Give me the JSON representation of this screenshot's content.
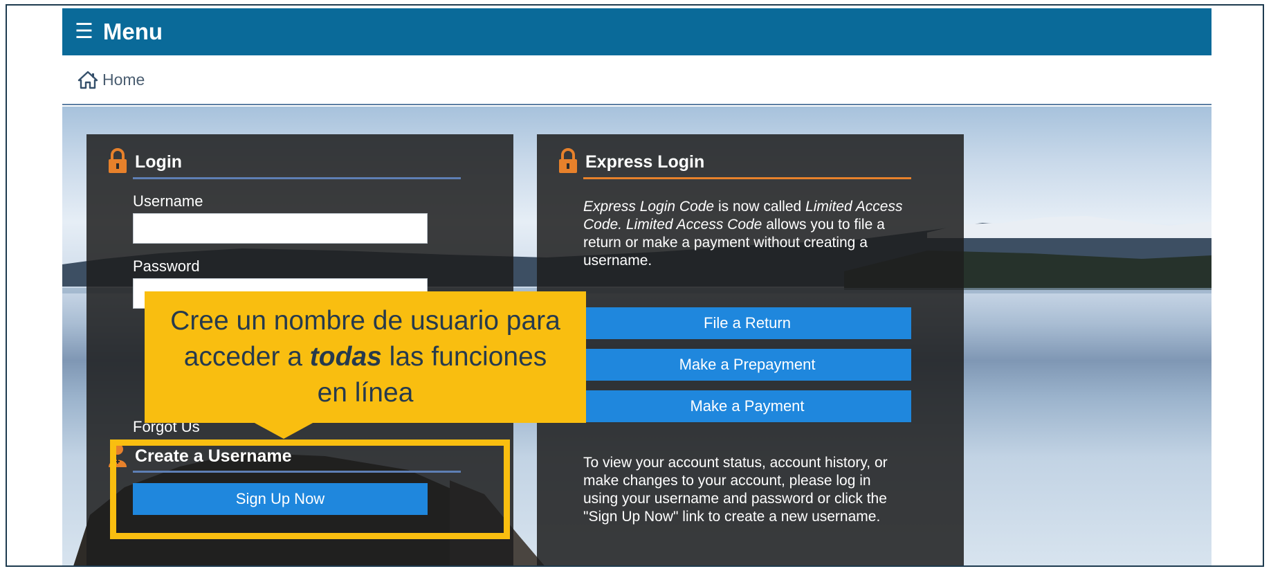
{
  "appbar": {
    "menu_label": "Menu",
    "menu_icon": "hamburger-icon"
  },
  "breadcrumb": {
    "home_label": "Home",
    "home_icon": "home-icon"
  },
  "login": {
    "title": "Login",
    "username_label": "Username",
    "username_value": "",
    "password_label": "Password",
    "password_value": "",
    "forgot_partial": "Forgot Us",
    "create_title": "Create a Username",
    "signup_button": "Sign Up Now"
  },
  "express": {
    "title": "Express Login",
    "desc_1a": "Express Login Code",
    "desc_1b": " is now called ",
    "desc_1c": "Limited Access Code",
    "desc_1d": ". ",
    "desc_1e": "Limited Access Code",
    "desc_1f": " allows you to file a return or make a payment without creating a username.",
    "btn_file": "File a Return",
    "btn_prepay": "Make a Prepayment",
    "btn_pay": "Make a Payment",
    "desc_2": "To view your account status, account history, or make changes to your account, please log in using your username and password or click the \"Sign Up Now\" link to create a new username."
  },
  "callout": {
    "line_a": "Cree un nombre de usuario para acceder a ",
    "line_emph": "todas",
    "line_b": " las funciones en línea"
  },
  "colors": {
    "appbar": "#0a6a99",
    "callout": "#f9be10",
    "button": "#1f87dd",
    "lock": "#e7812b"
  }
}
